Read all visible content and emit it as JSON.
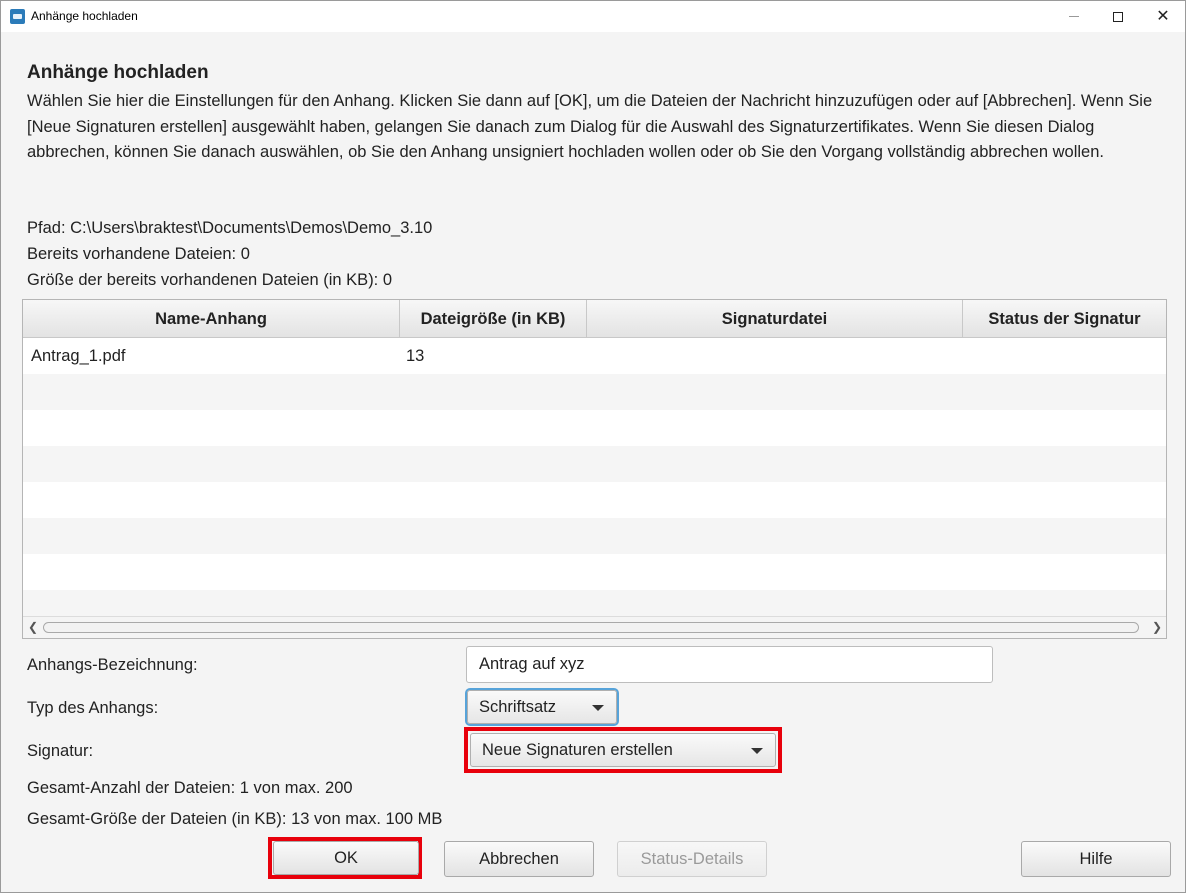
{
  "window": {
    "title": "Anhänge hochladen",
    "icon": "app-icon"
  },
  "heading": "Anhänge hochladen",
  "description": "Wählen Sie hier die Einstellungen für den Anhang. Klicken Sie dann auf [OK], um die Dateien der Nachricht hinzuzufügen oder auf [Abbrechen]. Wenn Sie [Neue Signaturen erstellen] ausgewählt haben, gelangen Sie danach zum Dialog für die Auswahl des Signaturzertifikates. Wenn Sie diesen Dialog abbrechen, können Sie danach auswählen, ob Sie den Anhang unsigniert hochladen wollen oder ob Sie den Vorgang vollständig abbrechen wollen.",
  "info": {
    "path": "Pfad: C:\\Users\\braktest\\Documents\\Demos\\Demo_3.10",
    "existing_files": "Bereits vorhandene Dateien: 0",
    "existing_size": "Größe der bereits vorhandenen Dateien (in KB): 0"
  },
  "table": {
    "columns": [
      "Name-Anhang",
      "Dateigröße (in KB)",
      "Signaturdatei",
      "Status der Signatur"
    ],
    "rows": [
      [
        "Antrag_1.pdf",
        "13",
        "",
        ""
      ]
    ]
  },
  "form": {
    "bezeichnung_label": "Anhangs-Bezeichnung:",
    "bezeichnung_value": "Antrag auf xyz",
    "typ_label": "Typ des Anhangs:",
    "typ_value": "Schriftsatz",
    "signatur_label": "Signatur:",
    "signatur_value": "Neue Signaturen erstellen"
  },
  "totals": {
    "count": "Gesamt-Anzahl der Dateien: 1 von max. 200",
    "size": "Gesamt-Größe der Dateien (in KB): 13 von max. 100 MB"
  },
  "buttons": {
    "ok": "OK",
    "cancel": "Abbrechen",
    "status_details": "Status-Details",
    "help": "Hilfe"
  },
  "colors": {
    "highlight": "#e8000b",
    "focus": "#57a3d9"
  }
}
